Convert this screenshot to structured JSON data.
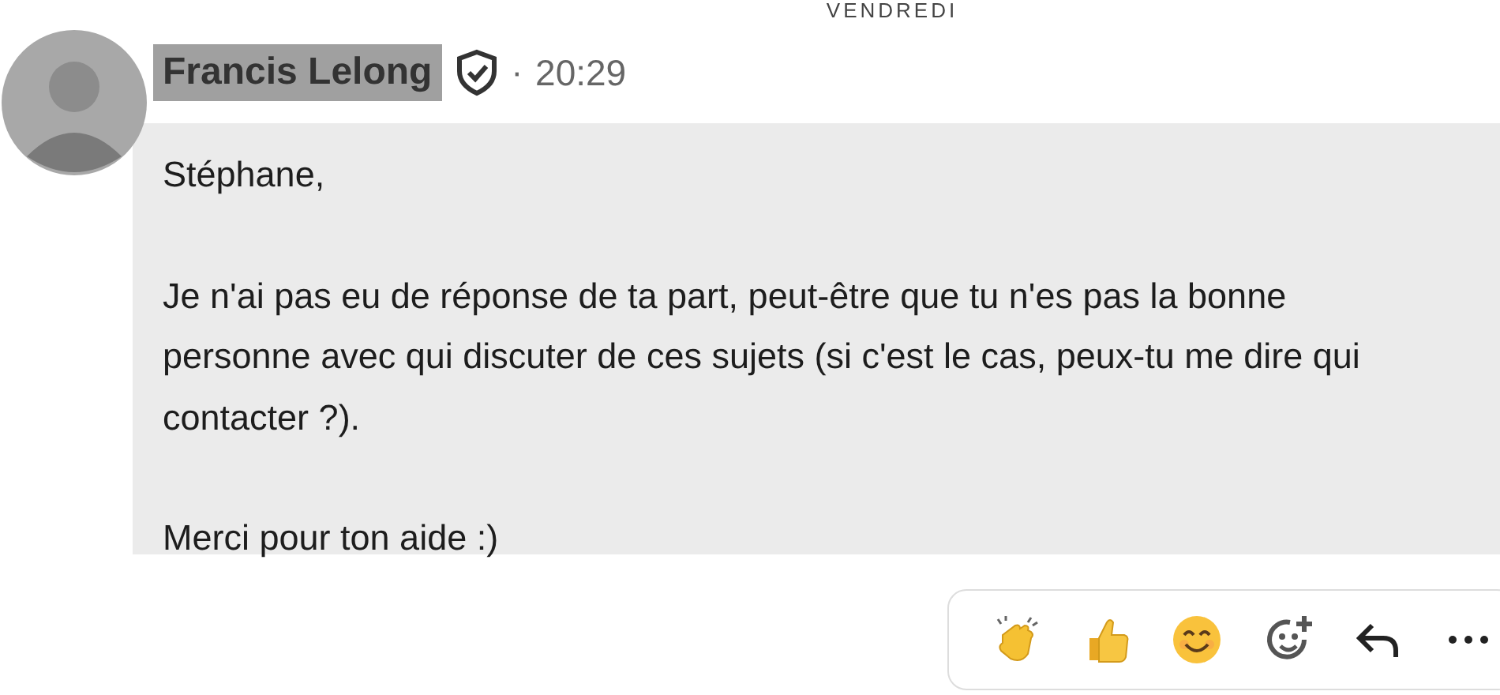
{
  "day_label": "VENDREDI",
  "message": {
    "sender": "Francis Lelong",
    "verified": true,
    "separator": "·",
    "time": "20:29",
    "paragraphs": [
      "Stéphane,",
      "Je n'ai pas eu de réponse de ta part, peut-être que tu n'es pas la bonne personne avec qui discuter de ces sujets (si c'est le cas, peux-tu me dire qui contacter ?).",
      "Merci pour ton aide :)"
    ]
  },
  "actions": [
    {
      "kind": "clap"
    },
    {
      "kind": "thumbs_up"
    },
    {
      "kind": "smile"
    },
    {
      "kind": "add_reaction"
    },
    {
      "kind": "reply"
    },
    {
      "kind": "more"
    }
  ]
}
